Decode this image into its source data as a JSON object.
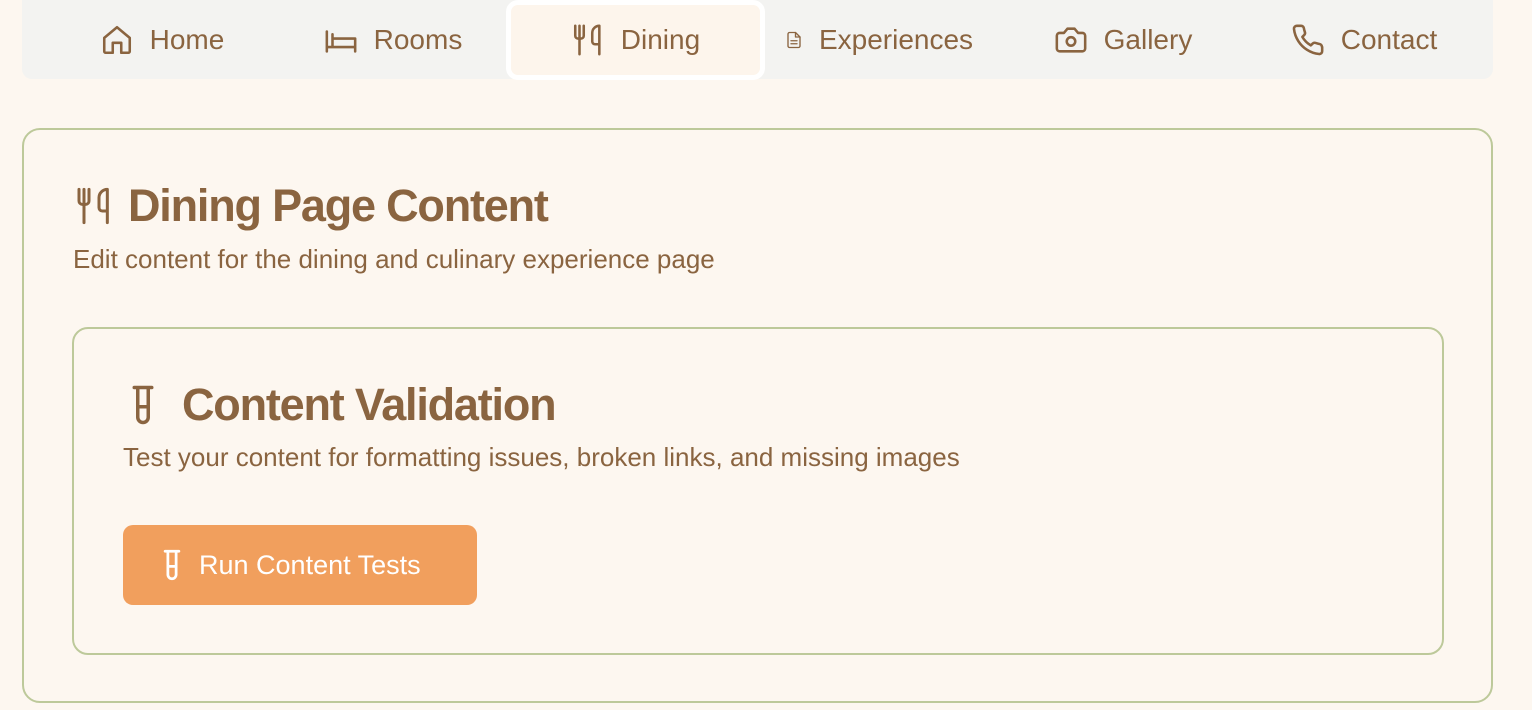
{
  "nav": {
    "tabs": [
      {
        "label": "Home",
        "icon": "home-icon"
      },
      {
        "label": "Rooms",
        "icon": "bed-icon"
      },
      {
        "label": "Dining",
        "icon": "utensils-icon",
        "active": true
      },
      {
        "label": "Experiences",
        "icon": "document-icon"
      },
      {
        "label": "Gallery",
        "icon": "camera-icon"
      },
      {
        "label": "Contact",
        "icon": "phone-icon"
      }
    ]
  },
  "page": {
    "title": "Dining Page Content",
    "title_icon": "utensils-icon",
    "subtitle": "Edit content for the dining and culinary experience page"
  },
  "validation": {
    "title": "Content Validation",
    "title_icon": "test-tube-icon",
    "description": "Test your content for formatting issues, broken links, and missing images",
    "button_label": "Run Content Tests",
    "button_icon": "test-tube-icon"
  },
  "colors": {
    "background": "#fdf7f0",
    "text": "#8a6440",
    "border": "#bdc99a",
    "accent": "#f19f5d",
    "tabbar": "#f3f3f1"
  }
}
